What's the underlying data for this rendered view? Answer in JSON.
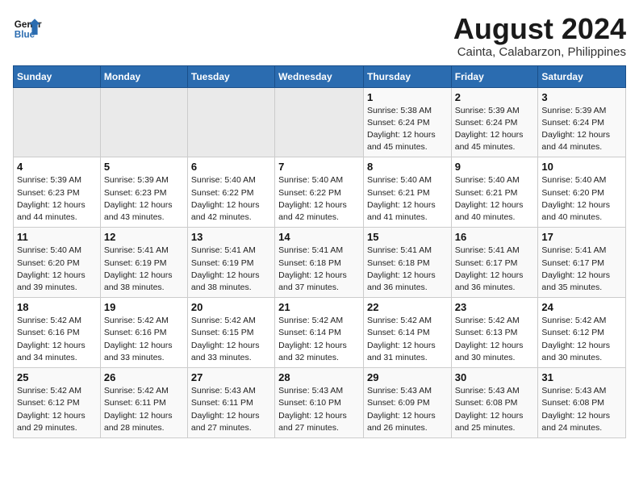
{
  "header": {
    "logo_line1": "General",
    "logo_line2": "Blue",
    "title": "August 2024",
    "subtitle": "Cainta, Calabarzon, Philippines"
  },
  "days_of_week": [
    "Sunday",
    "Monday",
    "Tuesday",
    "Wednesday",
    "Thursday",
    "Friday",
    "Saturday"
  ],
  "weeks": [
    [
      {
        "day": "",
        "info": ""
      },
      {
        "day": "",
        "info": ""
      },
      {
        "day": "",
        "info": ""
      },
      {
        "day": "",
        "info": ""
      },
      {
        "day": "1",
        "info": "Sunrise: 5:38 AM\nSunset: 6:24 PM\nDaylight: 12 hours and 45 minutes."
      },
      {
        "day": "2",
        "info": "Sunrise: 5:39 AM\nSunset: 6:24 PM\nDaylight: 12 hours and 45 minutes."
      },
      {
        "day": "3",
        "info": "Sunrise: 5:39 AM\nSunset: 6:24 PM\nDaylight: 12 hours and 44 minutes."
      }
    ],
    [
      {
        "day": "4",
        "info": "Sunrise: 5:39 AM\nSunset: 6:23 PM\nDaylight: 12 hours and 44 minutes."
      },
      {
        "day": "5",
        "info": "Sunrise: 5:39 AM\nSunset: 6:23 PM\nDaylight: 12 hours and 43 minutes."
      },
      {
        "day": "6",
        "info": "Sunrise: 5:40 AM\nSunset: 6:22 PM\nDaylight: 12 hours and 42 minutes."
      },
      {
        "day": "7",
        "info": "Sunrise: 5:40 AM\nSunset: 6:22 PM\nDaylight: 12 hours and 42 minutes."
      },
      {
        "day": "8",
        "info": "Sunrise: 5:40 AM\nSunset: 6:21 PM\nDaylight: 12 hours and 41 minutes."
      },
      {
        "day": "9",
        "info": "Sunrise: 5:40 AM\nSunset: 6:21 PM\nDaylight: 12 hours and 40 minutes."
      },
      {
        "day": "10",
        "info": "Sunrise: 5:40 AM\nSunset: 6:20 PM\nDaylight: 12 hours and 40 minutes."
      }
    ],
    [
      {
        "day": "11",
        "info": "Sunrise: 5:40 AM\nSunset: 6:20 PM\nDaylight: 12 hours and 39 minutes."
      },
      {
        "day": "12",
        "info": "Sunrise: 5:41 AM\nSunset: 6:19 PM\nDaylight: 12 hours and 38 minutes."
      },
      {
        "day": "13",
        "info": "Sunrise: 5:41 AM\nSunset: 6:19 PM\nDaylight: 12 hours and 38 minutes."
      },
      {
        "day": "14",
        "info": "Sunrise: 5:41 AM\nSunset: 6:18 PM\nDaylight: 12 hours and 37 minutes."
      },
      {
        "day": "15",
        "info": "Sunrise: 5:41 AM\nSunset: 6:18 PM\nDaylight: 12 hours and 36 minutes."
      },
      {
        "day": "16",
        "info": "Sunrise: 5:41 AM\nSunset: 6:17 PM\nDaylight: 12 hours and 36 minutes."
      },
      {
        "day": "17",
        "info": "Sunrise: 5:41 AM\nSunset: 6:17 PM\nDaylight: 12 hours and 35 minutes."
      }
    ],
    [
      {
        "day": "18",
        "info": "Sunrise: 5:42 AM\nSunset: 6:16 PM\nDaylight: 12 hours and 34 minutes."
      },
      {
        "day": "19",
        "info": "Sunrise: 5:42 AM\nSunset: 6:16 PM\nDaylight: 12 hours and 33 minutes."
      },
      {
        "day": "20",
        "info": "Sunrise: 5:42 AM\nSunset: 6:15 PM\nDaylight: 12 hours and 33 minutes."
      },
      {
        "day": "21",
        "info": "Sunrise: 5:42 AM\nSunset: 6:14 PM\nDaylight: 12 hours and 32 minutes."
      },
      {
        "day": "22",
        "info": "Sunrise: 5:42 AM\nSunset: 6:14 PM\nDaylight: 12 hours and 31 minutes."
      },
      {
        "day": "23",
        "info": "Sunrise: 5:42 AM\nSunset: 6:13 PM\nDaylight: 12 hours and 30 minutes."
      },
      {
        "day": "24",
        "info": "Sunrise: 5:42 AM\nSunset: 6:12 PM\nDaylight: 12 hours and 30 minutes."
      }
    ],
    [
      {
        "day": "25",
        "info": "Sunrise: 5:42 AM\nSunset: 6:12 PM\nDaylight: 12 hours and 29 minutes."
      },
      {
        "day": "26",
        "info": "Sunrise: 5:42 AM\nSunset: 6:11 PM\nDaylight: 12 hours and 28 minutes."
      },
      {
        "day": "27",
        "info": "Sunrise: 5:43 AM\nSunset: 6:11 PM\nDaylight: 12 hours and 27 minutes."
      },
      {
        "day": "28",
        "info": "Sunrise: 5:43 AM\nSunset: 6:10 PM\nDaylight: 12 hours and 27 minutes."
      },
      {
        "day": "29",
        "info": "Sunrise: 5:43 AM\nSunset: 6:09 PM\nDaylight: 12 hours and 26 minutes."
      },
      {
        "day": "30",
        "info": "Sunrise: 5:43 AM\nSunset: 6:08 PM\nDaylight: 12 hours and 25 minutes."
      },
      {
        "day": "31",
        "info": "Sunrise: 5:43 AM\nSunset: 6:08 PM\nDaylight: 12 hours and 24 minutes."
      }
    ]
  ]
}
